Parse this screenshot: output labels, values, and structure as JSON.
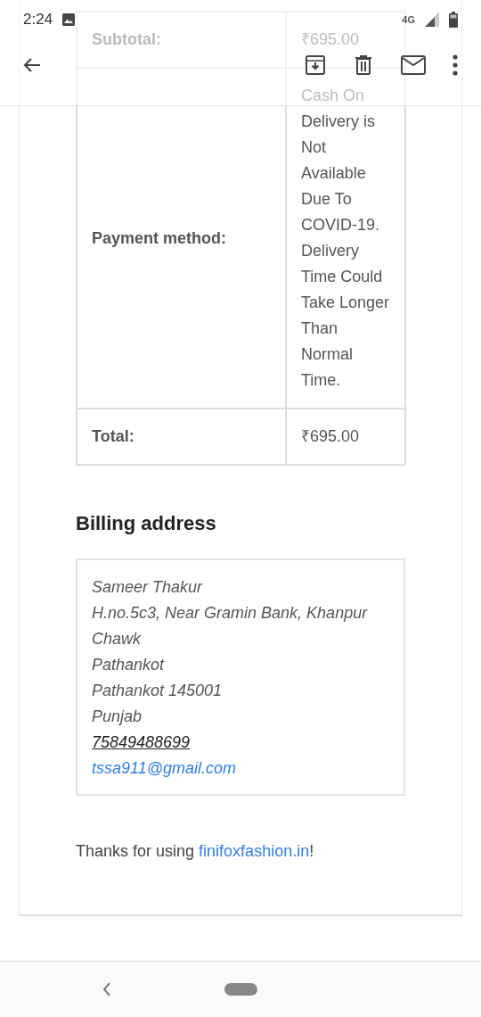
{
  "status_bar": {
    "time": "2:24",
    "network": "4G"
  },
  "order_table": {
    "rows": [
      {
        "label": "Subtotal:",
        "value": "₹695.00"
      },
      {
        "label": "Payment method:",
        "value": "Cash On Delivery is Not Available Due To COVID-19. Delivery Time Could Take Longer Than Normal Time."
      },
      {
        "label": "Total:",
        "value": "₹695.00"
      }
    ]
  },
  "billing": {
    "heading": "Billing address",
    "lines": [
      "Sameer Thakur",
      "H.no.5c3, Near Gramin Bank, Khanpur Chawk",
      "Pathankot",
      "Pathankot 145001",
      "Punjab"
    ],
    "phone": "75849488699",
    "email": "tssa911@gmail.com"
  },
  "footer": {
    "text": "Thanks for using ",
    "link": "finifoxfashion.in",
    "suffix": "!"
  }
}
